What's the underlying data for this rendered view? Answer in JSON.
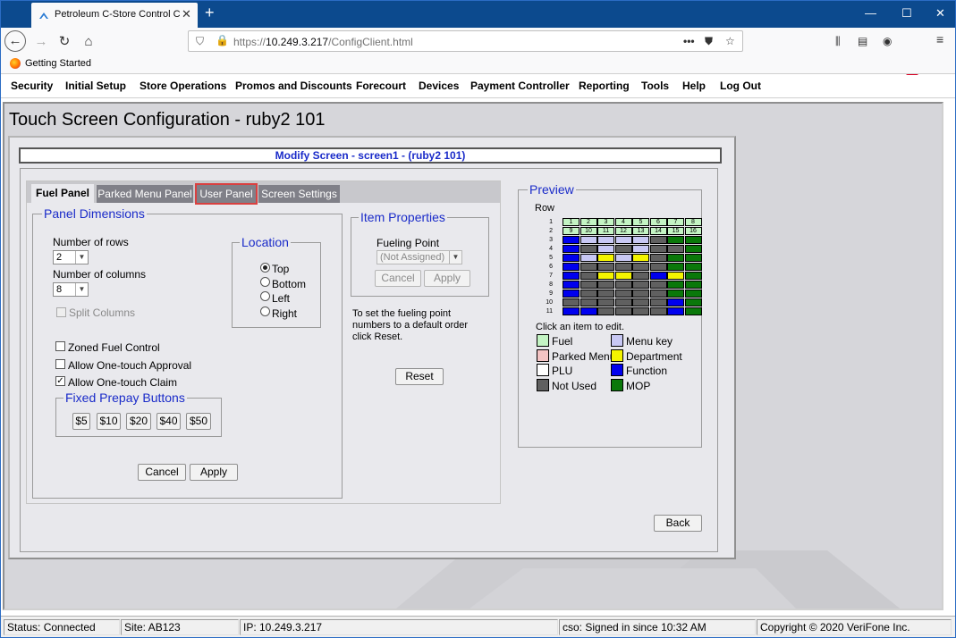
{
  "browser": {
    "tab_title": "Petroleum C-Store Control Cen",
    "url_host": "10.249.3.217",
    "url_scheme": "https://",
    "url_path": "/ConfigClient.html",
    "bookmark": "Getting Started"
  },
  "menu": [
    "Security",
    "Initial Setup",
    "Store Operations",
    "Promos and Discounts",
    "Forecourt",
    "Devices",
    "Payment Controller",
    "Reporting",
    "Tools",
    "Help",
    "Log Out"
  ],
  "page": {
    "title": "Touch Screen Configuration - ruby2 101",
    "dialog_title": "Modify Screen - screen1 - (ruby2 101)"
  },
  "tabs": [
    "Fuel Panel",
    "Parked Menu Panel",
    "User Panel",
    "Screen Settings"
  ],
  "panel_dimensions": {
    "legend": "Panel Dimensions",
    "rows_label": "Number of rows",
    "rows_value": "2",
    "cols_label": "Number of columns",
    "cols_value": "8",
    "split_columns": "Split Columns"
  },
  "location": {
    "legend": "Location",
    "options": [
      "Top",
      "Bottom",
      "Left",
      "Right"
    ],
    "selected": "Top"
  },
  "options": {
    "zoned": "Zoned Fuel Control",
    "one_touch_approval": "Allow One-touch Approval",
    "one_touch_claim": "Allow One-touch Claim"
  },
  "prepay": {
    "legend": "Fixed Prepay Buttons",
    "buttons": [
      "$5",
      "$10",
      "$20",
      "$40",
      "$50"
    ]
  },
  "form_buttons": {
    "cancel": "Cancel",
    "apply": "Apply"
  },
  "item_properties": {
    "legend": "Item Properties",
    "fueling_point_label": "Fueling Point",
    "fueling_point_value": "(Not Assigned)",
    "cancel": "Cancel",
    "apply": "Apply",
    "help_text_1": "To set the fueling point",
    "help_text_2": "numbers to a default order",
    "help_text_3": "click Reset.",
    "reset": "Reset"
  },
  "preview": {
    "legend": "Preview",
    "row_label": "Row",
    "click_text": "Click an item to edit.",
    "row_numbers": [
      "1",
      "2",
      "3",
      "4",
      "5",
      "6",
      "7",
      "8",
      "9",
      "10",
      "11"
    ],
    "fuel_numbers": [
      [
        "1",
        "2",
        "3",
        "4",
        "5",
        "6",
        "7",
        "8"
      ],
      [
        "9",
        "10",
        "11",
        "12",
        "13",
        "14",
        "15",
        "16"
      ]
    ],
    "grid_rows": [
      "FMMMMOGG",
      "FOMOMOOG",
      "FMDMDOGG",
      "FOOOOOGG",
      "FODDOFDG",
      "FOOOOOGG",
      "FOOOOOGG",
      "OOOOOOFG",
      "FFOOOOFG"
    ],
    "colors": {
      "F": "#0000ee",
      "M": "#c8c8f4",
      "D": "#f4f400",
      "O": "#606060",
      "G": "#0a780a",
      "fuel": "#c4f4c4"
    },
    "legend_items": [
      {
        "label": "Fuel",
        "color": "#c4f4c4"
      },
      {
        "label": "Menu key",
        "color": "#c8c8f4"
      },
      {
        "label": "Parked Menu",
        "color": "#f4c4c4"
      },
      {
        "label": "Department",
        "color": "#f4f400"
      },
      {
        "label": "PLU",
        "color": "#ffffff"
      },
      {
        "label": "Function",
        "color": "#0000ee"
      },
      {
        "label": "Not Used",
        "color": "#606060"
      },
      {
        "label": "MOP",
        "color": "#0a780a"
      }
    ]
  },
  "back": "Back",
  "status": {
    "connected": "Status: Connected",
    "site": "Site: AB123",
    "ip": "IP: 10.249.3.217",
    "cso": "cso: Signed in since 10:32 AM",
    "copyright": "Copyright © 2020 VeriFone Inc."
  }
}
